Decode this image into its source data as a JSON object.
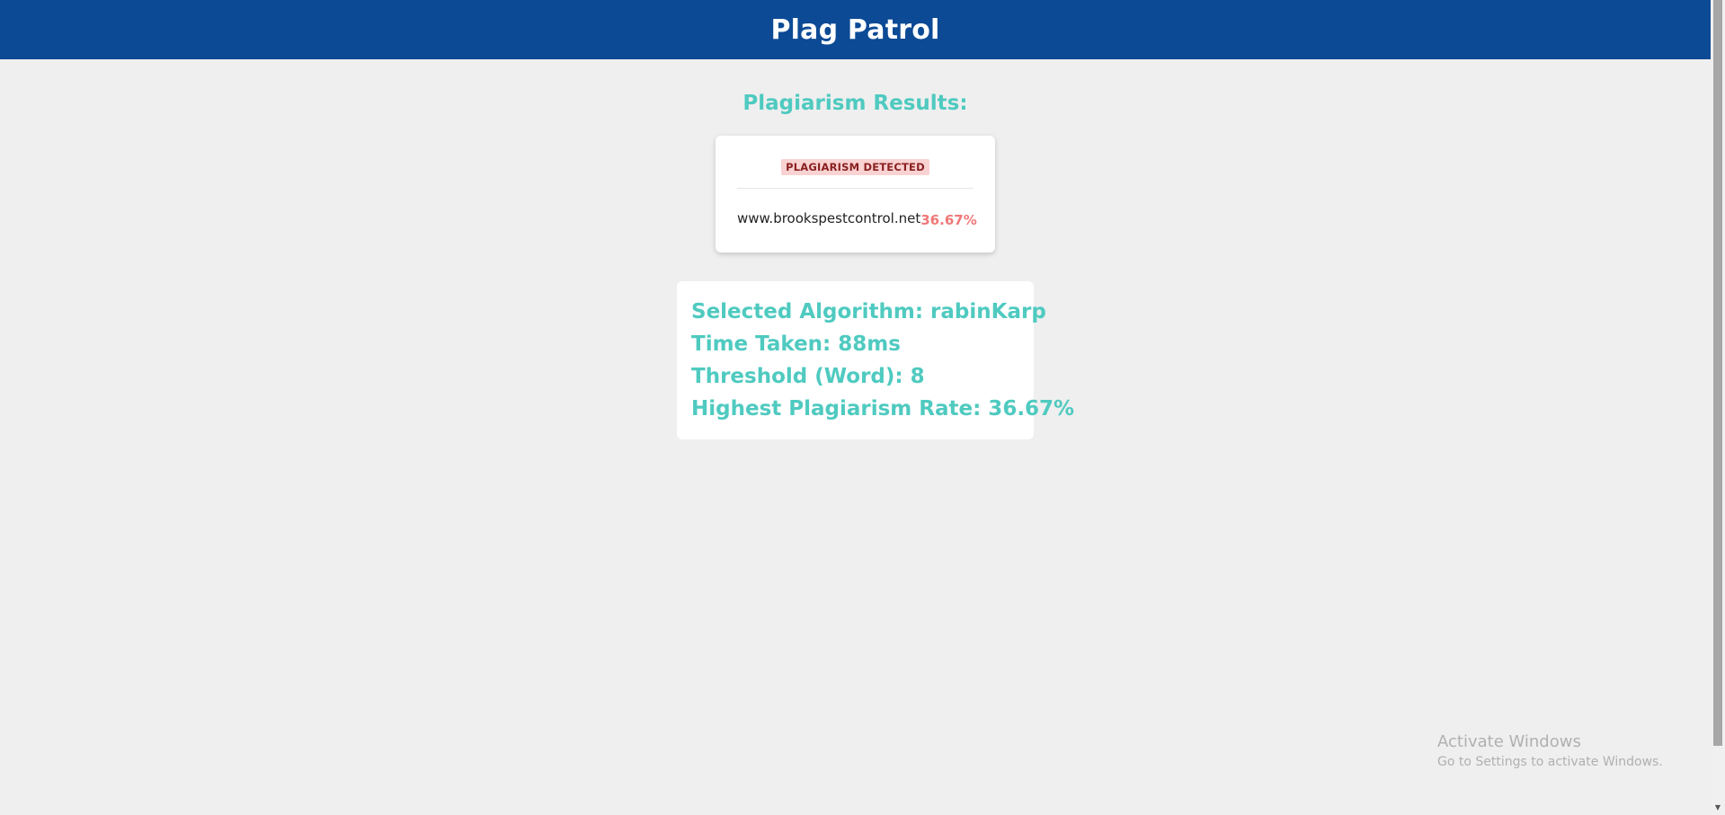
{
  "header": {
    "title": "Plag Patrol",
    "background_color": "#0c4a95"
  },
  "results": {
    "heading": "Plagiarism Results:",
    "accent_color": "#4fcac0",
    "status_badge": "PLAGIARISM DETECTED",
    "matches": [
      {
        "source": "www.brookspestcontrol.net",
        "rate": "36.67%"
      }
    ]
  },
  "stats": {
    "algorithm": "Selected Algorithm: rabinKarp",
    "time_taken": "Time Taken: 88ms",
    "threshold": "Threshold (Word): 8",
    "highest_rate": "Highest Plagiarism Rate: 36.67%"
  },
  "watermark": {
    "title": "Activate Windows",
    "subtitle": "Go to Settings to activate Windows."
  },
  "scrollbar": {
    "down_arrow_icon": "chevron-down-icon"
  }
}
